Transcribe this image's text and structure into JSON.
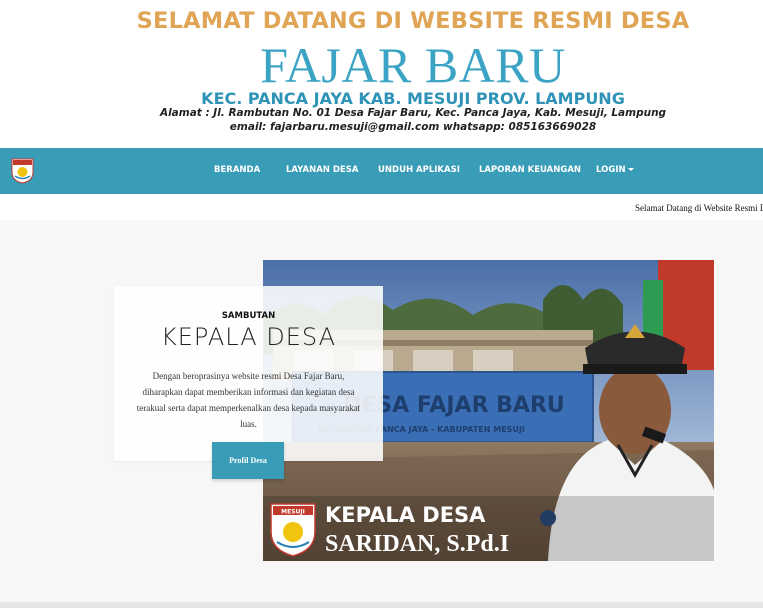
{
  "header": {
    "welcome": "SELAMAT DATANG DI WEBSITE RESMI DESA",
    "village_name": "FAJAR BARU",
    "district": "KEC. PANCA JAYA KAB. MESUJI PROV. LAMPUNG",
    "address": "Alamat : Jl. Rambutan No. 01 Desa Fajar Baru, Kec. Panca Jaya, Kab. Mesuji, Lampung",
    "contact": "email: fajarbaru.mesuji@gmail.com whatsapp: 085163669028"
  },
  "nav": {
    "items": [
      {
        "label": "BERANDA"
      },
      {
        "label": "LAYANAN DESA"
      },
      {
        "label": "UNDUH APLIKASI"
      },
      {
        "label": "LAPORAN KEUANGAN"
      },
      {
        "label": "LOGIN"
      }
    ]
  },
  "marquee": {
    "text": "Selamat Datang di Website Resmi De"
  },
  "hero": {
    "kicker": "SAMBUTAN",
    "title": "KEPALA DESA",
    "body": "Dengan beroprasinya website resmi Desa Fajar Baru, diharapkan dapat memberikan informasi dan kegiatan desa terakual serta dapat memperkenalkan desa kepada masyarakat luas.",
    "button_label": "Profil Desa"
  },
  "photo": {
    "sign_text": "DESA FAJAR BARU",
    "sign_subtext": "KECAMATAN PANCA JAYA - KABUPATEN MESUJI",
    "caption_role": "KEPALA DESA",
    "caption_name": "SARIDAN, S.Pd.I",
    "emblem_label": "MESUJI"
  },
  "colors": {
    "accent": "#3a9db8",
    "welcome": "#e0a455",
    "village": "#3ba3c4"
  }
}
